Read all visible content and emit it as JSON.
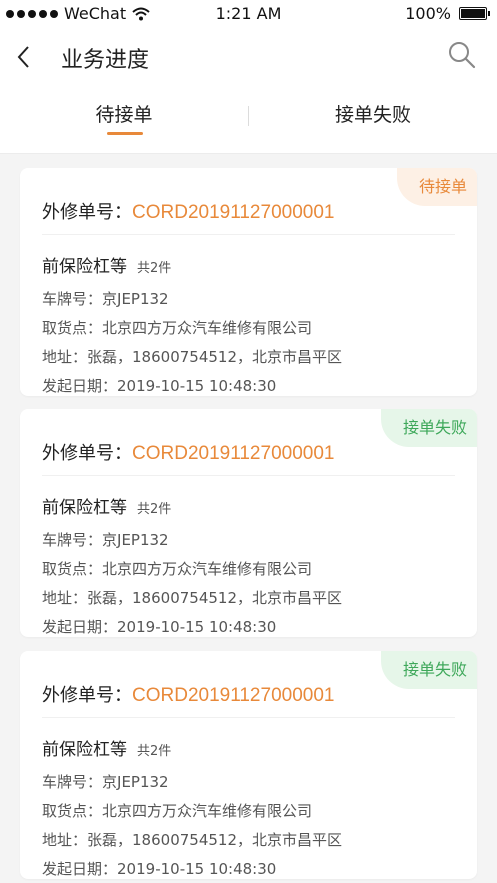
{
  "status_bar": {
    "carrier": "WeChat",
    "time": "1:21 AM",
    "battery": "100%"
  },
  "nav": {
    "title": "业务进度"
  },
  "tabs": [
    {
      "label": "待接单",
      "active": true
    },
    {
      "label": "接单失败",
      "active": false
    }
  ],
  "colors": {
    "accent": "#e8893a",
    "success": "#3ea85a",
    "background": "#f4f4f4"
  },
  "cards": [
    {
      "status": "待接单",
      "status_type": "pending",
      "order_label": "外修单号：",
      "order_no": "CORD20191127000001",
      "item_name": "前保险杠等",
      "item_count": "共2件",
      "plate_label": "车牌号：",
      "plate": "京JEP132",
      "pickup_label": "取货点：",
      "pickup": "北京四方万众汽车维修有限公司",
      "address_label": "地址：",
      "address": "张磊，18600754512，北京市昌平区",
      "date_label": "发起日期：",
      "date": "2019-10-15 10:48:30"
    },
    {
      "status": "接单失败",
      "status_type": "failed",
      "order_label": "外修单号：",
      "order_no": "CORD20191127000001",
      "item_name": "前保险杠等",
      "item_count": "共2件",
      "plate_label": "车牌号：",
      "plate": "京JEP132",
      "pickup_label": "取货点：",
      "pickup": "北京四方万众汽车维修有限公司",
      "address_label": "地址：",
      "address": "张磊，18600754512，北京市昌平区",
      "date_label": "发起日期：",
      "date": "2019-10-15 10:48:30"
    },
    {
      "status": "接单失败",
      "status_type": "failed",
      "order_label": "外修单号：",
      "order_no": "CORD20191127000001",
      "item_name": "前保险杠等",
      "item_count": "共2件",
      "plate_label": "车牌号：",
      "plate": "京JEP132",
      "pickup_label": "取货点：",
      "pickup": "北京四方万众汽车维修有限公司",
      "address_label": "地址：",
      "address": "张磊，18600754512，北京市昌平区",
      "date_label": "发起日期：",
      "date": "2019-10-15 10:48:30"
    }
  ]
}
